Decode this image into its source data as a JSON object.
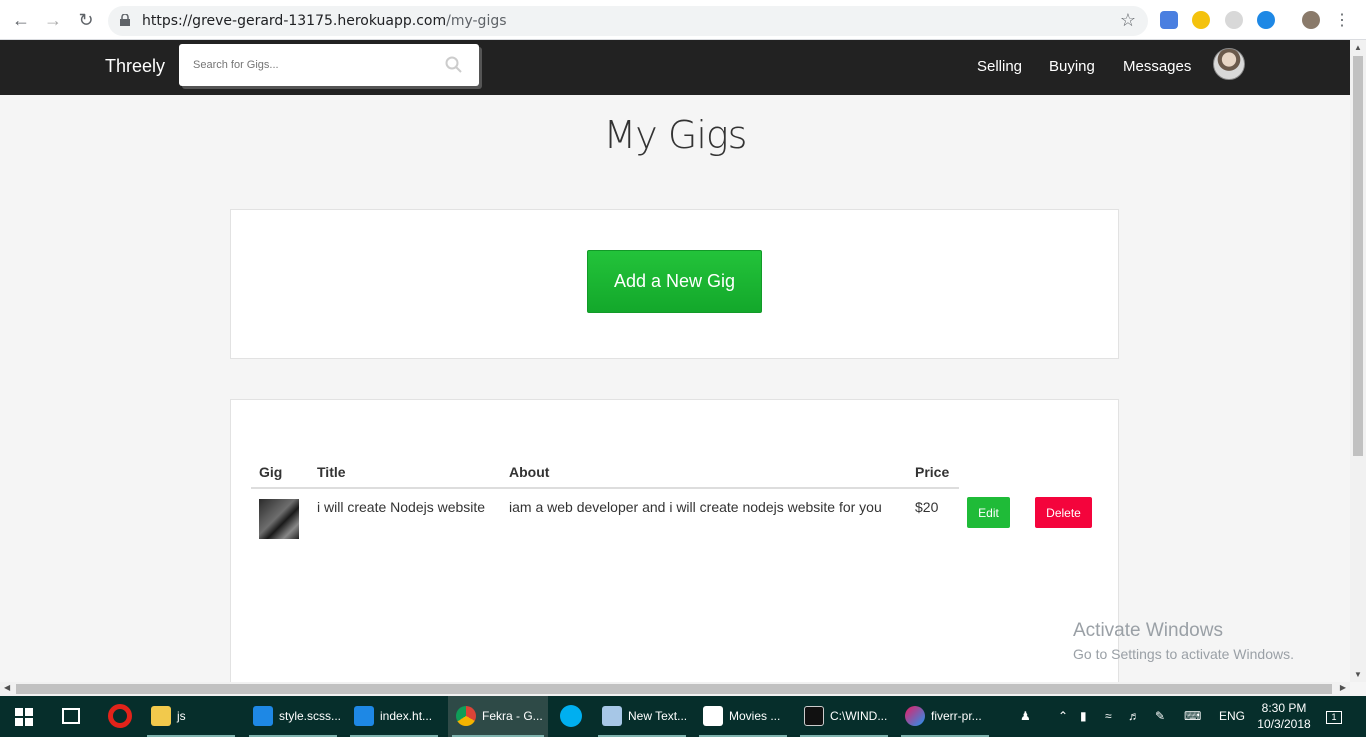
{
  "browser": {
    "url_host": "https://greve-gerard-13175.herokuapp.com",
    "url_path": "/my-gigs"
  },
  "site": {
    "brand": "Threely",
    "search_placeholder": "Search for Gigs...",
    "nav": [
      "Selling",
      "Buying",
      "Messages"
    ]
  },
  "page": {
    "title": "My Gigs",
    "add_button": "Add a New Gig"
  },
  "table": {
    "headers": [
      "Gig",
      "Title",
      "About",
      "Price"
    ],
    "rows": [
      {
        "title": "i will create Nodejs website",
        "about": "iam a web developer and i will create nodejs website for you",
        "price": "$20",
        "edit_label": "Edit",
        "delete_label": "Delete"
      }
    ]
  },
  "watermark": {
    "line1": "Activate Windows",
    "line2": "Go to Settings to activate Windows."
  },
  "taskbar": {
    "items": [
      "js",
      "style.scss...",
      "index.ht...",
      "Fekra - G...",
      "New Text...",
      "Movies ...",
      "C:\\WIND...",
      "fiverr-pr..."
    ],
    "lang": "ENG",
    "time": "8:30 PM",
    "date": "10/3/2018",
    "notifications": "1"
  },
  "colors": {
    "navbar": "#222222",
    "add_button": "#1fbb38",
    "delete_button": "#f4043c",
    "taskbar": "#062e2b"
  }
}
